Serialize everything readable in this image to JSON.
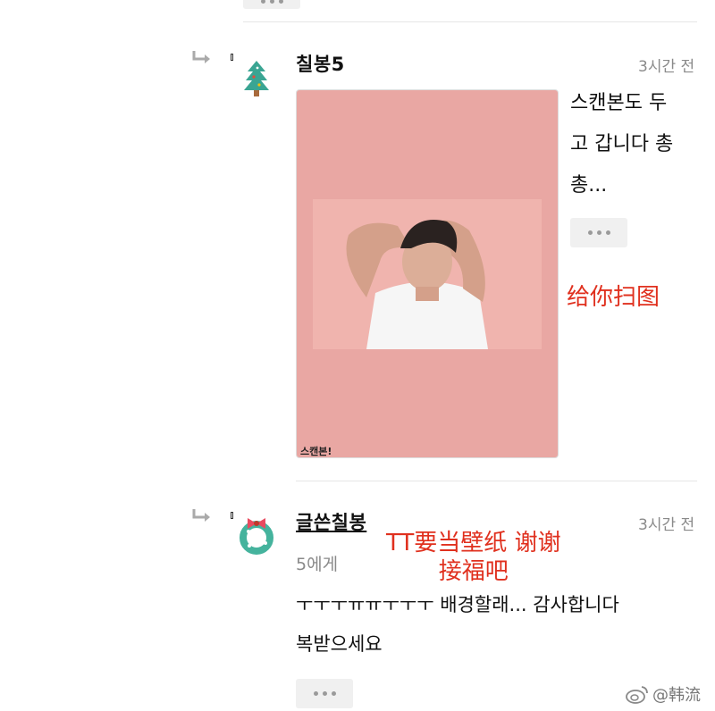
{
  "top_more_button": {
    "icon": "more-dots-icon"
  },
  "comments": [
    {
      "author": "칠봉5",
      "time": "3시간 전",
      "avatar": "christmas-tree-avatar",
      "body": [
        "스캔본도 두",
        "고 갑니다 총",
        "총..."
      ],
      "scan_caption": "스캔본!",
      "annotation": "给你扫图",
      "colors": {
        "image_bg": "#e9a7a3",
        "photo_bg": "#f0b4ae"
      }
    },
    {
      "author": "글쓴칠봉",
      "time": "3시간 전",
      "avatar": "wreath-avatar",
      "mention": "5에게",
      "body": [
        "ㅜㅜㅜㅠㅠㅜㅜㅜ 배경할래... 감사합니다",
        "복받으세요"
      ],
      "annotation": [
        "TT要当壁纸 谢谢",
        "接福吧"
      ]
    }
  ],
  "watermark": {
    "text": "@韩流",
    "icon": "weibo-logo-icon"
  },
  "colors": {
    "annotation": "#e0301e",
    "time": "#8a8a8a",
    "divider": "#e6e6e6"
  }
}
